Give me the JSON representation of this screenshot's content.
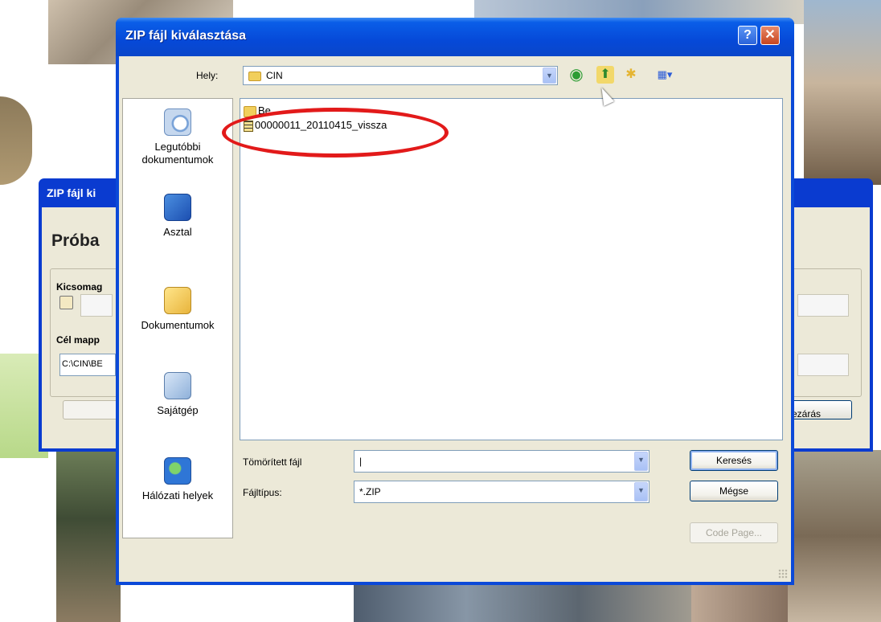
{
  "background_dialog": {
    "title": "ZIP fájl ki",
    "heading": "Próba",
    "package_label": "Kicsomag",
    "target_label": "Cél mapp",
    "target_value": "C:\\CIN\\BE",
    "close_button_label": "ezárás"
  },
  "dialog": {
    "title": "ZIP fájl kiválasztása",
    "help_label": "?",
    "close_label": "✕",
    "look_in_label": "Hely:",
    "look_in_value": "CIN",
    "toolbar": {
      "back_glyph": "◉",
      "up_glyph": "⬆",
      "new_folder_glyph": "✱",
      "view_glyph": "▦▾"
    },
    "places": [
      {
        "label": "Legutóbbi dokumentumok",
        "icon": "recent-documents-icon"
      },
      {
        "label": "Asztal",
        "icon": "desktop-icon"
      },
      {
        "label": "Dokumentumok",
        "icon": "my-documents-icon"
      },
      {
        "label": "Sajátgép",
        "icon": "my-computer-icon"
      },
      {
        "label": "Hálózati helyek",
        "icon": "network-places-icon"
      }
    ],
    "files": [
      {
        "name": "Be",
        "type": "folder"
      },
      {
        "name": "00000011_20110415_vissza",
        "type": "zip"
      }
    ],
    "filename_label": "Tömörített fájl",
    "filename_value": "|",
    "filetype_label": "Fájltípus:",
    "filetype_value": "*.ZIP",
    "search_button": "Keresés",
    "cancel_button": "Mégse",
    "codepage_button": "Code Page..."
  },
  "colors": {
    "titlebar": "#0649d8",
    "dialog_face": "#ece9d8",
    "highlight_ellipse": "#e21a1a"
  }
}
